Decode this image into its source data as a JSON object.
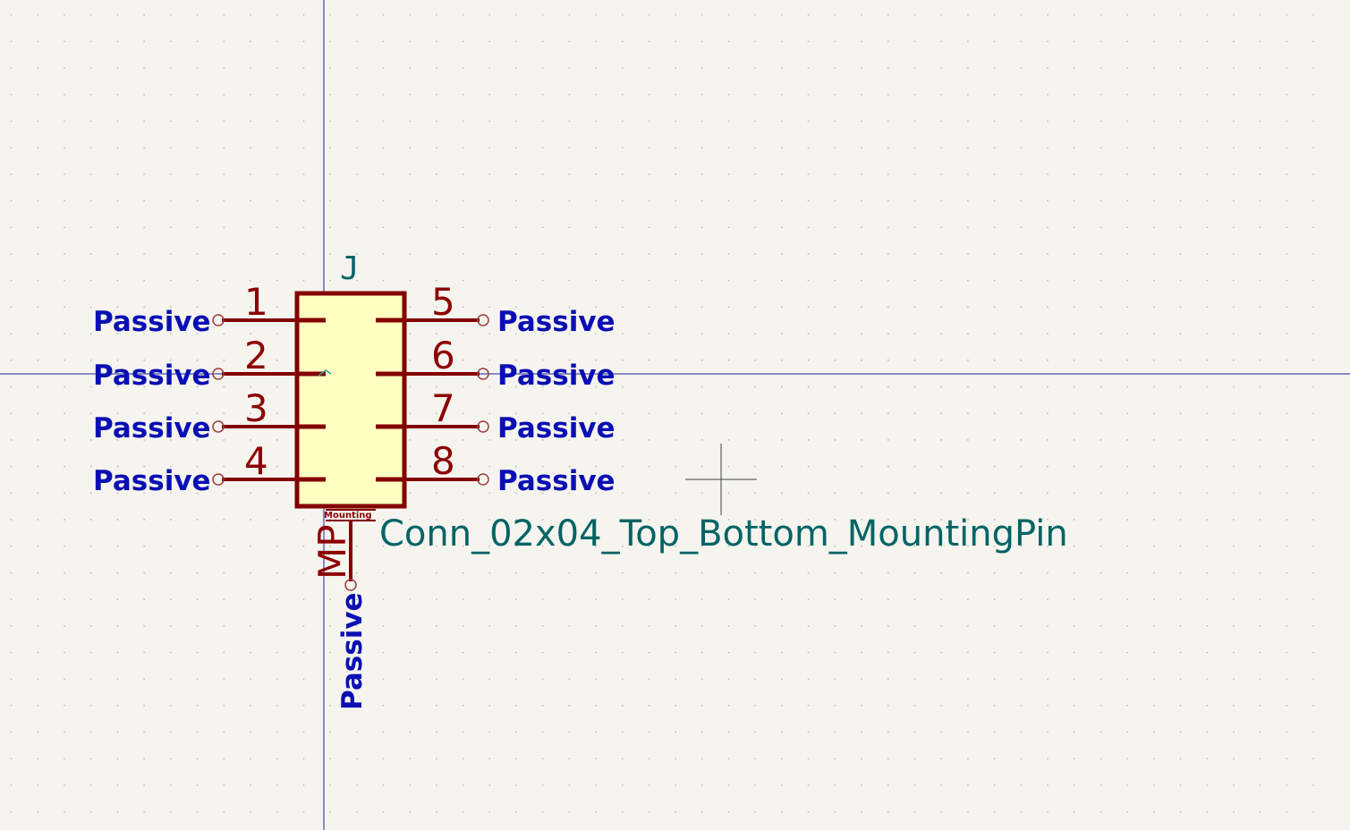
{
  "schematic": {
    "reference": "J",
    "value": "Conn_02x04_Top_Bottom_MountingPin",
    "mounting_label": "Mounting",
    "colors": {
      "background": "#f5f4ef",
      "grid_dot": "#b4b4aa",
      "axis": "#1e2596",
      "body_fill": "#ffffc2",
      "body_outline": "#840000",
      "pin_line": "#840000",
      "pin_number": "#8c0000",
      "pin_type": "#0a0fb4",
      "field_text": "#006464",
      "cursor": "#404040"
    },
    "pins_left": [
      {
        "number": "1",
        "type": "Passive"
      },
      {
        "number": "2",
        "type": "Passive"
      },
      {
        "number": "3",
        "type": "Passive"
      },
      {
        "number": "4",
        "type": "Passive"
      }
    ],
    "pins_right": [
      {
        "number": "5",
        "type": "Passive"
      },
      {
        "number": "6",
        "type": "Passive"
      },
      {
        "number": "7",
        "type": "Passive"
      },
      {
        "number": "8",
        "type": "Passive"
      }
    ],
    "pin_bottom": {
      "number": "MP",
      "type": "Passive"
    }
  }
}
